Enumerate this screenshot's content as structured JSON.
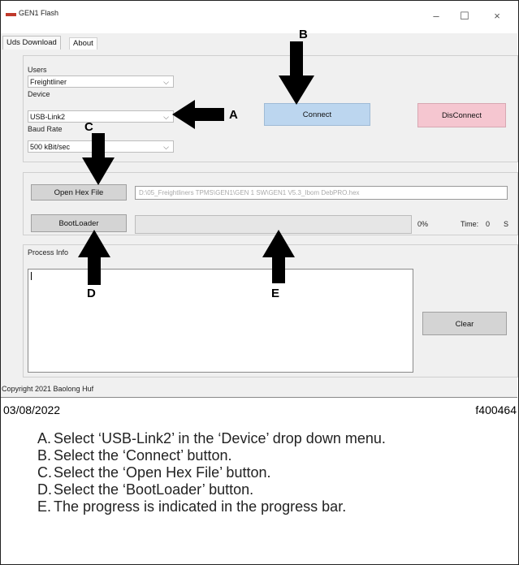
{
  "window": {
    "title": "GEN1 Flash",
    "controls": {
      "minimize": "–",
      "maximize": "☐",
      "close": "×"
    }
  },
  "tabs": [
    {
      "label": "Uds Download"
    },
    {
      "label": "About"
    }
  ],
  "connection": {
    "users_label": "Users",
    "users_value": "Freightliner",
    "device_label": "Device",
    "device_value": "USB-Link2",
    "baud_label": "Baud Rate",
    "baud_value": "500 kBit/sec",
    "connect_label": "Connect",
    "disconnect_label": "DisConnect"
  },
  "flash": {
    "open_hex_label": "Open Hex File",
    "hex_path": "D:\\05_Freightliners TPMS\\GEN1\\GEN 1 SW\\GEN1 V5.3_Ibom DebPRO.hex",
    "bootloader_label": "BootLoader",
    "progress_percent": "0%",
    "time_label": "Time:",
    "time_value": "0",
    "time_unit": "S",
    "progress_fraction": 0
  },
  "process": {
    "label": "Process Info",
    "clear_label": "Clear"
  },
  "copyright": "Copyright 2021 Baolong Huf",
  "callouts": {
    "a": "A",
    "b": "B",
    "c": "C",
    "d": "D",
    "e": "E"
  },
  "figure": {
    "date": "03/08/2022",
    "id": "f400464"
  },
  "steps": [
    {
      "key": "A.",
      "text": "Select ‘USB-Link2’ in the ‘Device’ drop down menu."
    },
    {
      "key": "B.",
      "text": "Select the ‘Connect’ button."
    },
    {
      "key": "C.",
      "text": "Select the ‘Open Hex File’ button."
    },
    {
      "key": "D.",
      "text": "Select the ‘BootLoader’ button."
    },
    {
      "key": "E.",
      "text": "The progress is indicated in the progress bar."
    }
  ],
  "colors": {
    "connect_bg": "#bcd6ef",
    "disconnect_bg": "#f5c6d0",
    "button_gray": "#d8d8d8"
  }
}
